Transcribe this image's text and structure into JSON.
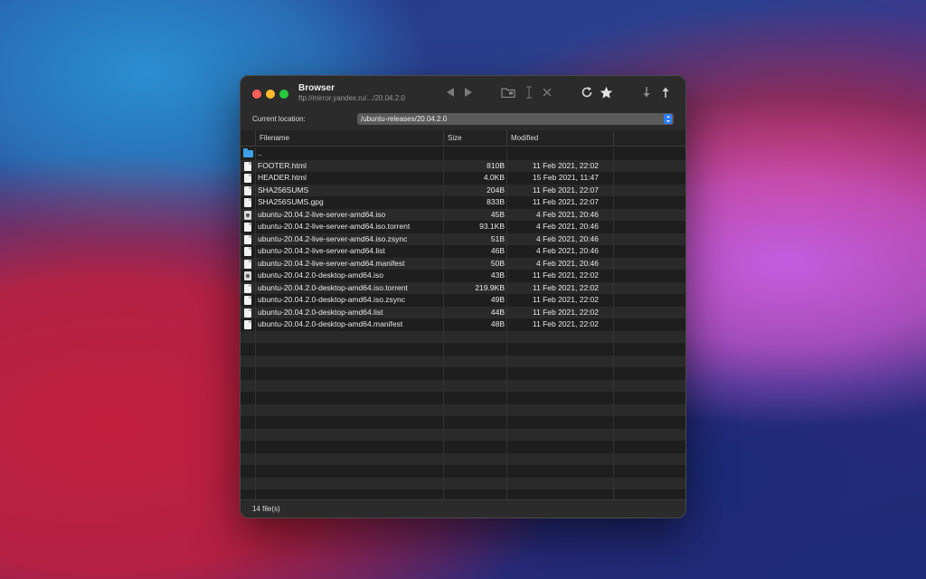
{
  "window": {
    "title": "Browser",
    "subtitle": "ftp://mirror.yandex.ru/.../20.04.2.0"
  },
  "toolbar": {
    "icons": [
      "back-arrow-icon",
      "forward-arrow-icon",
      "new-folder-icon",
      "rename-icon",
      "delete-icon",
      "refresh-icon",
      "bookmark-star-icon",
      "download-icon",
      "upload-icon"
    ]
  },
  "location": {
    "label": "Current location:",
    "value": "/ubuntu-releases/20.04.2.0"
  },
  "table": {
    "headers": {
      "filename": "Filename",
      "size": "Size",
      "modified": "Modified"
    },
    "parent": {
      "name": "..",
      "icon": "folder-icon"
    },
    "files": [
      {
        "name": "FOOTER.html",
        "size": "810B",
        "modified": "11 Feb 2021, 22:02",
        "icon": "file-icon"
      },
      {
        "name": "HEADER.html",
        "size": "4.0KB",
        "modified": "15 Feb 2021, 11:47",
        "icon": "file-icon"
      },
      {
        "name": "SHA256SUMS",
        "size": "204B",
        "modified": "11 Feb 2021, 22:07",
        "icon": "file-icon"
      },
      {
        "name": "SHA256SUMS.gpg",
        "size": "833B",
        "modified": "11 Feb 2021, 22:07",
        "icon": "file-icon"
      },
      {
        "name": "ubuntu-20.04.2-live-server-amd64.iso",
        "size": "45B",
        "modified": "4 Feb 2021, 20:46",
        "icon": "disk-image-icon"
      },
      {
        "name": "ubuntu-20.04.2-live-server-amd64.iso.torrent",
        "size": "93.1KB",
        "modified": "4 Feb 2021, 20:46",
        "icon": "file-icon"
      },
      {
        "name": "ubuntu-20.04.2-live-server-amd64.iso.zsync",
        "size": "51B",
        "modified": "4 Feb 2021, 20:46",
        "icon": "file-icon"
      },
      {
        "name": "ubuntu-20.04.2-live-server-amd64.list",
        "size": "46B",
        "modified": "4 Feb 2021, 20:46",
        "icon": "file-icon"
      },
      {
        "name": "ubuntu-20.04.2-live-server-amd64.manifest",
        "size": "50B",
        "modified": "4 Feb 2021, 20:46",
        "icon": "file-icon"
      },
      {
        "name": "ubuntu-20.04.2.0-desktop-amd64.iso",
        "size": "43B",
        "modified": "11 Feb 2021, 22:02",
        "icon": "disk-image-icon"
      },
      {
        "name": "ubuntu-20.04.2.0-desktop-amd64.iso.torrent",
        "size": "219.9KB",
        "modified": "11 Feb 2021, 22:02",
        "icon": "file-icon"
      },
      {
        "name": "ubuntu-20.04.2.0-desktop-amd64.iso.zsync",
        "size": "49B",
        "modified": "11 Feb 2021, 22:02",
        "icon": "file-icon"
      },
      {
        "name": "ubuntu-20.04.2.0-desktop-amd64.list",
        "size": "44B",
        "modified": "11 Feb 2021, 22:02",
        "icon": "file-icon"
      },
      {
        "name": "ubuntu-20.04.2.0-desktop-amd64.manifest",
        "size": "48B",
        "modified": "11 Feb 2021, 22:02",
        "icon": "file-icon"
      }
    ]
  },
  "status": {
    "text": "14 file(s)"
  },
  "colors": {
    "close": "#ff5f57",
    "minimize": "#febc2e",
    "maximize": "#28c840",
    "accent": "#2f7ef5",
    "folder": "#3fa0e6"
  }
}
